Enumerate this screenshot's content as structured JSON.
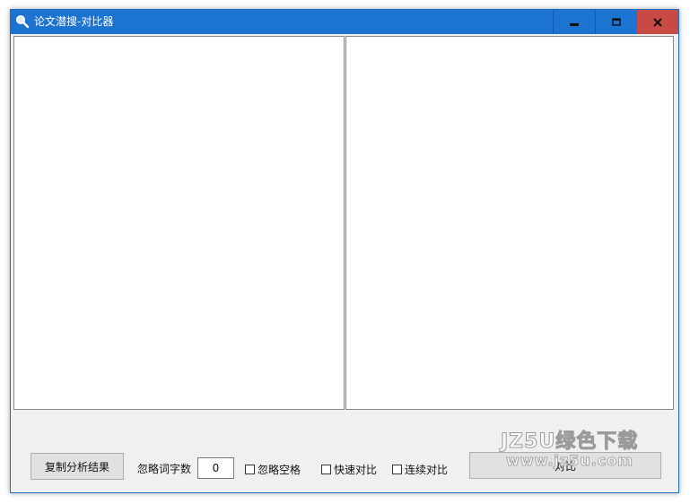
{
  "window": {
    "title": "论文潜搜-对比器",
    "icon": "magnifier-icon"
  },
  "controls": {
    "minimize": "minimize-icon",
    "maximize": "maximize-icon",
    "close": "close-icon"
  },
  "panes": {
    "left_text": "",
    "right_text": ""
  },
  "bottom": {
    "copy_button_label": "复制分析结果",
    "ignore_count_label": "忽略词字数",
    "ignore_count_value": "0",
    "ignore_space_label": "忽略空格",
    "fast_compare_label": "快速对比",
    "continuous_compare_label": "连续对比",
    "compare_button_label": "对比"
  },
  "watermark": {
    "title": "JZ5U绿色下载",
    "url": "www.jz5u.com"
  },
  "colors": {
    "titlebar": "#1d74d0",
    "close_button": "#c74a45",
    "background": "#f0f0f0"
  }
}
